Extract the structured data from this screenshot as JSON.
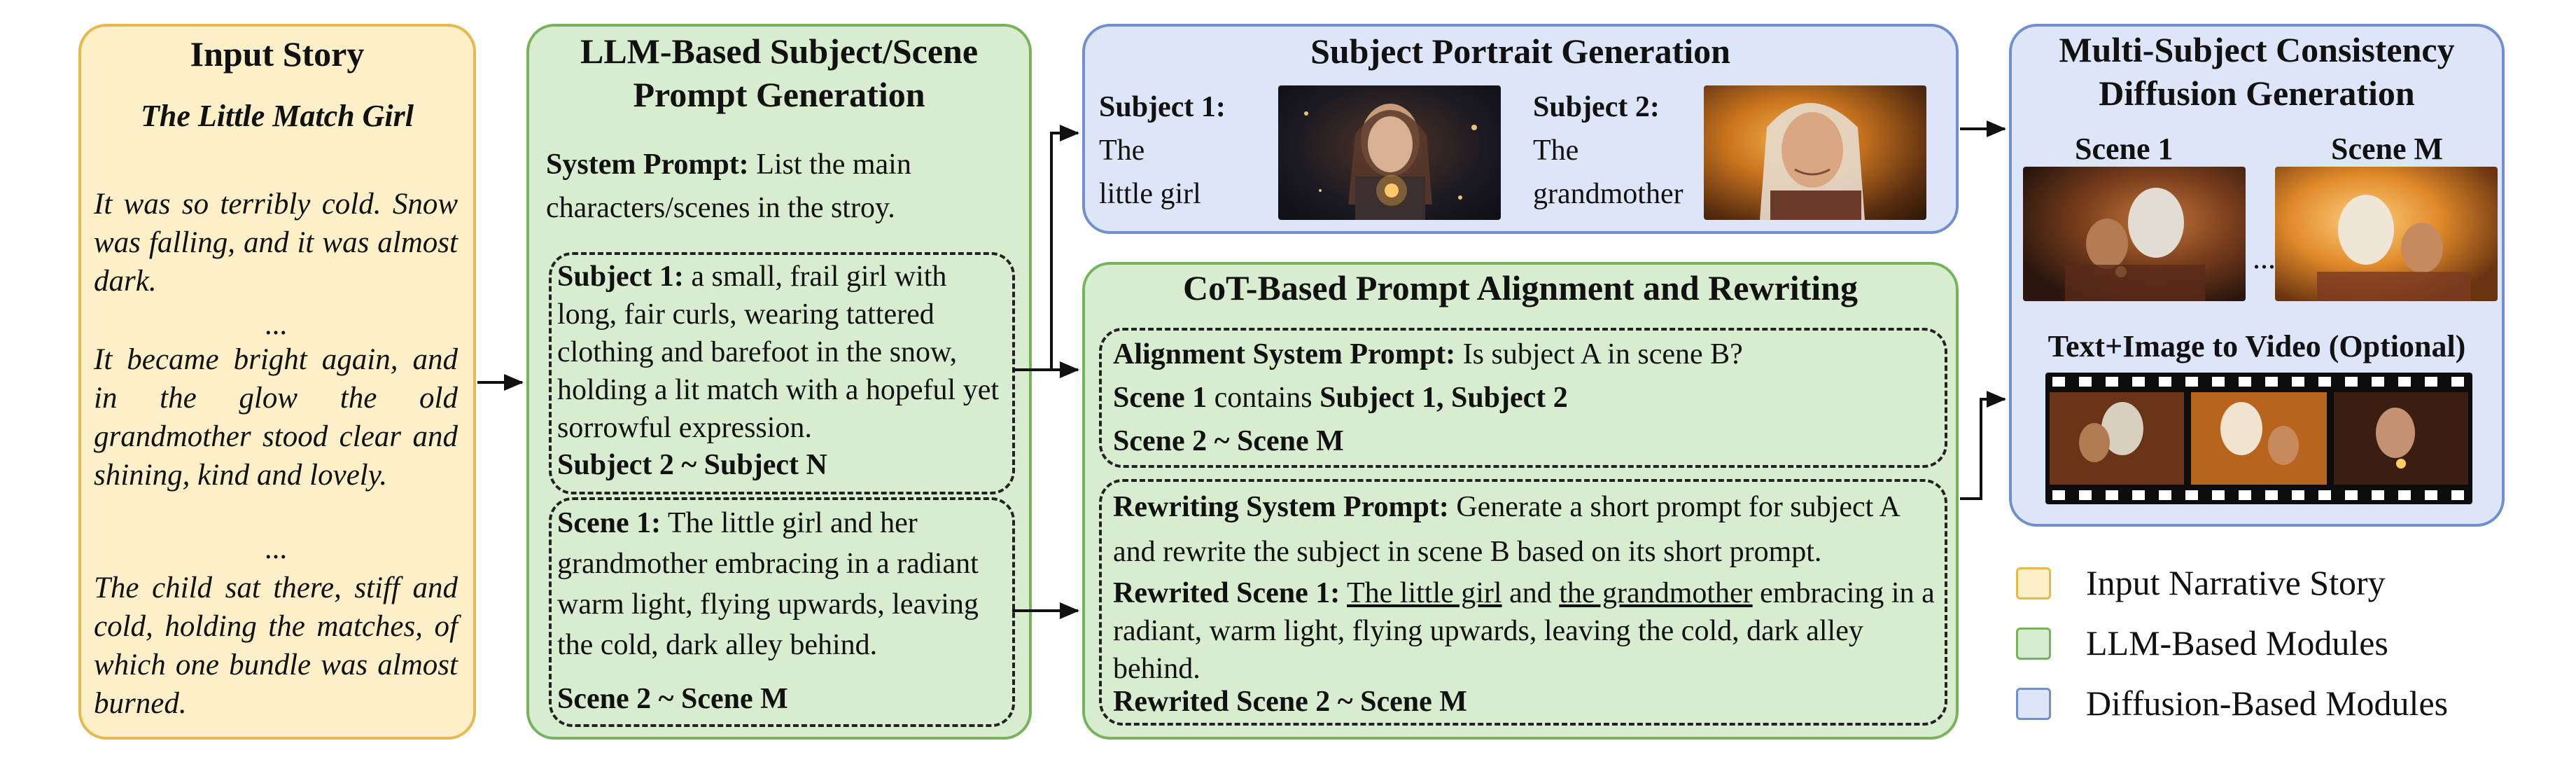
{
  "input_panel": {
    "title": "Input Story",
    "story_title": "The Little Match Girl",
    "para1": "It was so terribly cold. Snow was falling, and it was almost dark.",
    "ellipsis1": "...",
    "para2": "It became bright again, and in the glow the old grandmother stood clear and shining, kind and lovely.",
    "ellipsis2": "...",
    "para3": "The child sat there, stiff and cold, holding the matches, of which one bundle was almost burned."
  },
  "llm_panel": {
    "title_line1": "LLM-Based Subject/Scene",
    "title_line2": "Prompt Generation",
    "system_prompt_label": "System Prompt:",
    "system_prompt_text": "List the main characters/scenes in the stroy.",
    "subject1_label": "Subject 1:",
    "subject1_text": "a small, frail girl with long, fair curls, wearing tattered clothing and barefoot in the snow, holding a lit match with a hopeful yet sorrowful expression.",
    "subject_range": "Subject 2 ~ Subject N",
    "scene1_label": "Scene 1:",
    "scene1_text": "The little girl and her grandmother embracing in a radiant warm light, flying upwards, leaving the cold, dark alley behind.",
    "scene_range": "Scene 2 ~ Scene M"
  },
  "portrait_panel": {
    "title": "Subject Portrait Generation",
    "subject1_label": "Subject 1:",
    "subject1_line1": "The",
    "subject1_line2": "little girl",
    "subject2_label": "Subject 2:",
    "subject2_line1": "The",
    "subject2_line2": "grandmother"
  },
  "cot_panel": {
    "title": "CoT-Based Prompt Alignment and Rewriting",
    "alignment_label": "Alignment System Prompt:",
    "alignment_text": "Is subject A in scene B?",
    "scene1_contains_a": "Scene 1",
    "scene1_contains_b": "contains",
    "scene1_contains_c": "Subject 1, Subject 2",
    "scene_range": "Scene 2 ~ Scene M",
    "rewriting_label": "Rewriting System Prompt:",
    "rewriting_text": "Generate a short prompt for subject A and rewrite the subject in scene B based on its short prompt.",
    "rewrited_label": "Rewrited Scene 1:",
    "rewrited_u1": "The little girl",
    "rewrited_and": "and",
    "rewrited_u2": "the grandmother",
    "rewrited_rest": "embracing in a radiant, warm light, flying upwards, leaving the cold, dark alley behind.",
    "rewrited_range": "Rewrited Scene 2 ~ Scene M"
  },
  "diffusion_panel": {
    "title_line1": "Multi-Subject Consistency",
    "title_line2": "Diffusion Generation",
    "scene1_label": "Scene 1",
    "sceneM_label": "Scene M",
    "ellipsis": "...",
    "video_label": "Text+Image to Video (Optional)"
  },
  "legend": [
    {
      "label": "Input Narrative Story",
      "fill": "#fdf0c8",
      "stroke": "#e8b84a"
    },
    {
      "label": "LLM-Based Modules",
      "fill": "#d8eccf",
      "stroke": "#77b35c"
    },
    {
      "label": "Diffusion-Based Modules",
      "fill": "#dde6f8",
      "stroke": "#6f8fcf"
    }
  ],
  "colors": {
    "yellow_fill": "#fdf0c8",
    "green_fill": "#d8eccf",
    "blue_fill": "#dde6f8"
  }
}
